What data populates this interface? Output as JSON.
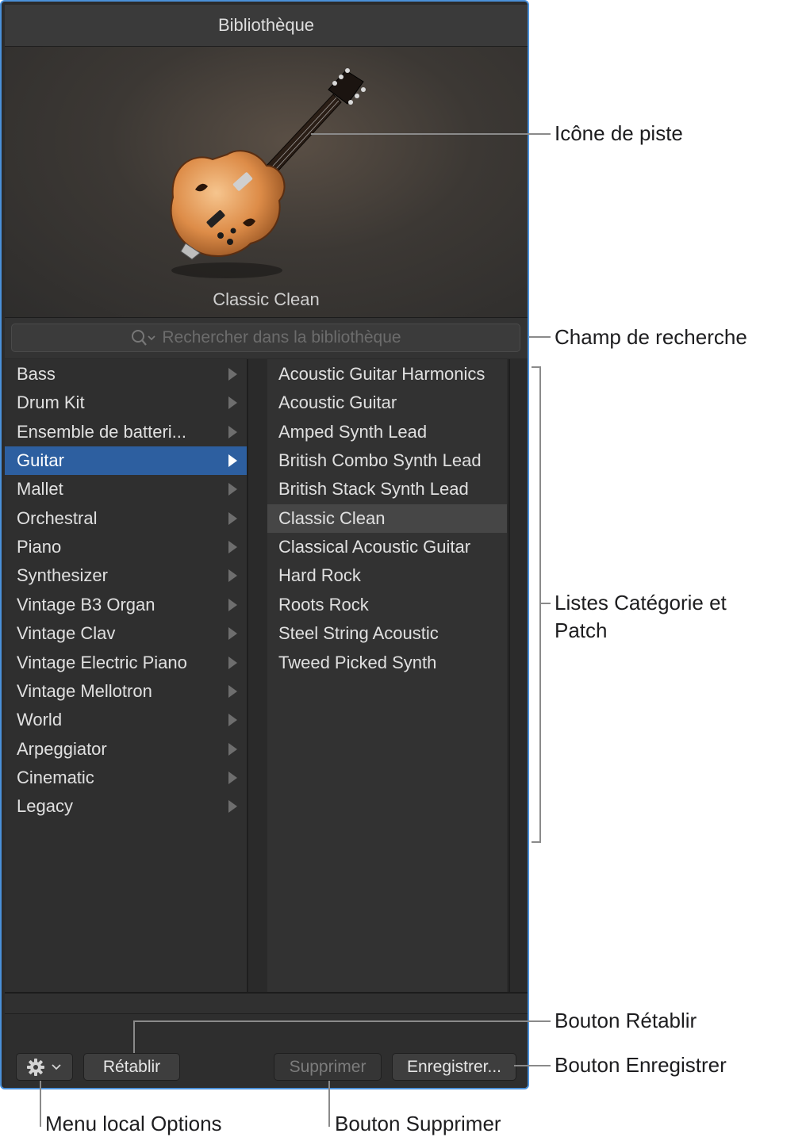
{
  "window": {
    "title": "Bibliothèque"
  },
  "track_icon": {
    "icon": "guitar-icon",
    "caption": "Classic Clean"
  },
  "search": {
    "placeholder": "Rechercher dans la bibliothèque"
  },
  "categories": [
    {
      "label": "Bass"
    },
    {
      "label": "Drum Kit"
    },
    {
      "label": "Ensemble de batteri..."
    },
    {
      "label": "Guitar",
      "selected": true
    },
    {
      "label": "Mallet"
    },
    {
      "label": "Orchestral"
    },
    {
      "label": "Piano"
    },
    {
      "label": "Synthesizer"
    },
    {
      "label": "Vintage B3 Organ"
    },
    {
      "label": "Vintage Clav"
    },
    {
      "label": "Vintage Electric Piano"
    },
    {
      "label": "Vintage Mellotron"
    },
    {
      "label": "World"
    },
    {
      "label": "Arpeggiator"
    },
    {
      "label": "Cinematic"
    },
    {
      "label": "Legacy"
    }
  ],
  "patches": [
    {
      "label": "Acoustic Guitar Harmonics"
    },
    {
      "label": "Acoustic Guitar"
    },
    {
      "label": "Amped Synth Lead"
    },
    {
      "label": "British Combo Synth Lead"
    },
    {
      "label": "British Stack Synth Lead"
    },
    {
      "label": "Classic Clean",
      "selected": true
    },
    {
      "label": "Classical Acoustic Guitar"
    },
    {
      "label": "Hard Rock"
    },
    {
      "label": "Roots Rock"
    },
    {
      "label": "Steel String Acoustic"
    },
    {
      "label": "Tweed Picked Synth"
    }
  ],
  "toolbar": {
    "options_icon": "gear-icon",
    "revert_label": "Rétablir",
    "delete_label": "Supprimer",
    "save_label": "Enregistrer..."
  },
  "callouts": {
    "track_icon": "Icône de piste",
    "search_field": "Champ de recherche",
    "lists_line1": "Listes Catégorie et",
    "lists_line2": "Patch",
    "revert_button": "Bouton Rétablir",
    "save_button": "Bouton Enregistrer",
    "options_menu": "Menu local Options",
    "delete_button": "Bouton Supprimer"
  },
  "colors": {
    "selection_blue": "#2d5fa0",
    "panel_background": "#2b2b2b"
  }
}
